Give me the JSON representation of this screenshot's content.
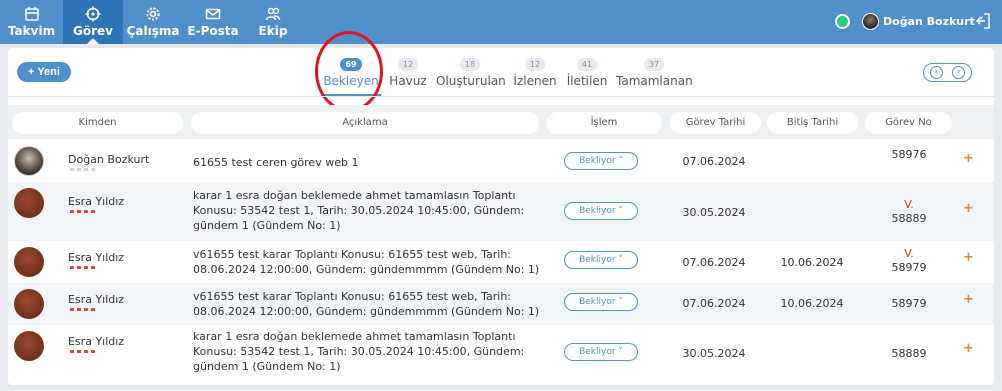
{
  "nav": {
    "items": [
      {
        "label": "Takvim",
        "icon": "calendar-icon"
      },
      {
        "label": "Görev",
        "icon": "crosshair-icon"
      },
      {
        "label": "Çalışma",
        "icon": "gear-icon"
      },
      {
        "label": "E-Posta",
        "icon": "mail-icon"
      },
      {
        "label": "Ekip",
        "icon": "team-icon"
      }
    ],
    "active": "Görev",
    "user_name": "Doğan Bozkurt ˅",
    "online_color": "#2ec98a"
  },
  "toolbar": {
    "new_label": "+ Yeni",
    "pager_prev": "‹",
    "pager_next": "›"
  },
  "tabs": [
    {
      "label": "Bekleyen",
      "count": "69"
    },
    {
      "label": "Havuz",
      "count": "12"
    },
    {
      "label": "Oluşturulan",
      "count": "18"
    },
    {
      "label": "İzlenen",
      "count": "12"
    },
    {
      "label": "İletilen",
      "count": "41"
    },
    {
      "label": "Tamamlanan",
      "count": "37"
    }
  ],
  "table": {
    "headers": [
      "Kimden",
      "Açıklama",
      "İşlem",
      "Görev Tarihi",
      "Bitiş Tarihi",
      "Görev No"
    ],
    "rows": [
      {
        "sender": "Doğan Bozkurt",
        "description": "61655   test ceren görev web 1",
        "status": "Bekliyor ˅",
        "task_date": "07.06.2024",
        "end_date": "",
        "flag": "",
        "task_no": "58976"
      },
      {
        "sender": "Esra Yıldız",
        "description": "karar 1 esra doğan beklemede ahmet tamamlasın Toplantı Konusu: 53542 test 1, Tarih: 30.05.2024 10:45:00, Gündem: gündem 1 (Gündem No: 1)",
        "status": "Bekliyor ˅",
        "task_date": "30.05.2024",
        "end_date": "",
        "flag": "V.",
        "task_no": "58889"
      },
      {
        "sender": "Esra Yıldız",
        "description": "v61655 test karar Toplantı Konusu: 61655 test web, Tarih: 08.06.2024 12:00:00, Gündem: gündemmmm (Gündem No: 1)",
        "status": "Bekliyor ˅",
        "task_date": "07.06.2024",
        "end_date": "10.06.2024",
        "flag": "V.",
        "task_no": "58979"
      },
      {
        "sender": "Esra Yıldız",
        "description": "v61655 test karar Toplantı Konusu: 61655 test web, Tarih: 08.06.2024 12:00:00, Gündem: gündemmmm (Gündem No: 1)",
        "status": "Bekliyor ˅",
        "task_date": "07.06.2024",
        "end_date": "10.06.2024",
        "flag": "",
        "task_no": "58979"
      },
      {
        "sender": "Esra Yıldız",
        "description": "karar 1 esra doğan beklemede ahmet tamamlasın Toplantı Konusu: 53542 test 1, Tarih: 30.05.2024 10:45:00, Gündem: gündem 1 (Gündem No: 1)",
        "status": "Bekliyor ˅",
        "task_date": "30.05.2024",
        "end_date": "",
        "flag": "",
        "task_no": "58889"
      }
    ],
    "add_label": "+"
  }
}
